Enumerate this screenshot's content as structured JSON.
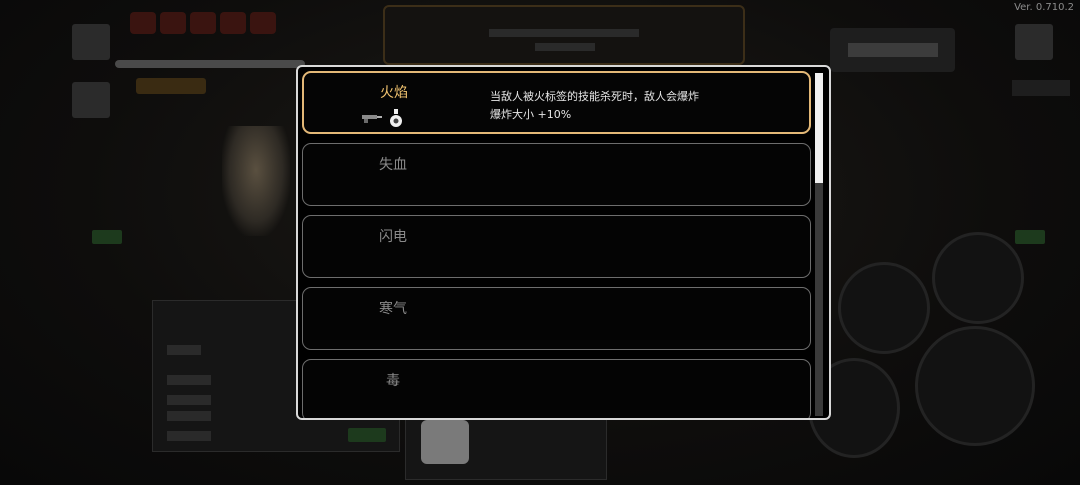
{
  "version": "Ver. 0.710.2",
  "modal": {
    "items": [
      {
        "title": "火焰",
        "selected": true,
        "description": [
          "当敌人被火标签的技能杀死时，敌人会爆炸",
          "爆炸大小 +10%"
        ],
        "icons": [
          "gun-icon",
          "potion-icon"
        ]
      },
      {
        "title": "失血",
        "selected": false
      },
      {
        "title": "闪电",
        "selected": false
      },
      {
        "title": "寒气",
        "selected": false
      },
      {
        "title": "毒",
        "selected": false
      }
    ],
    "scroll_position": 0
  },
  "colors": {
    "selected_border": "#e3b877",
    "selected_title": "#f2c470",
    "unselected_title": "#8a8a8a",
    "modal_border": "#d9d9d9"
  }
}
